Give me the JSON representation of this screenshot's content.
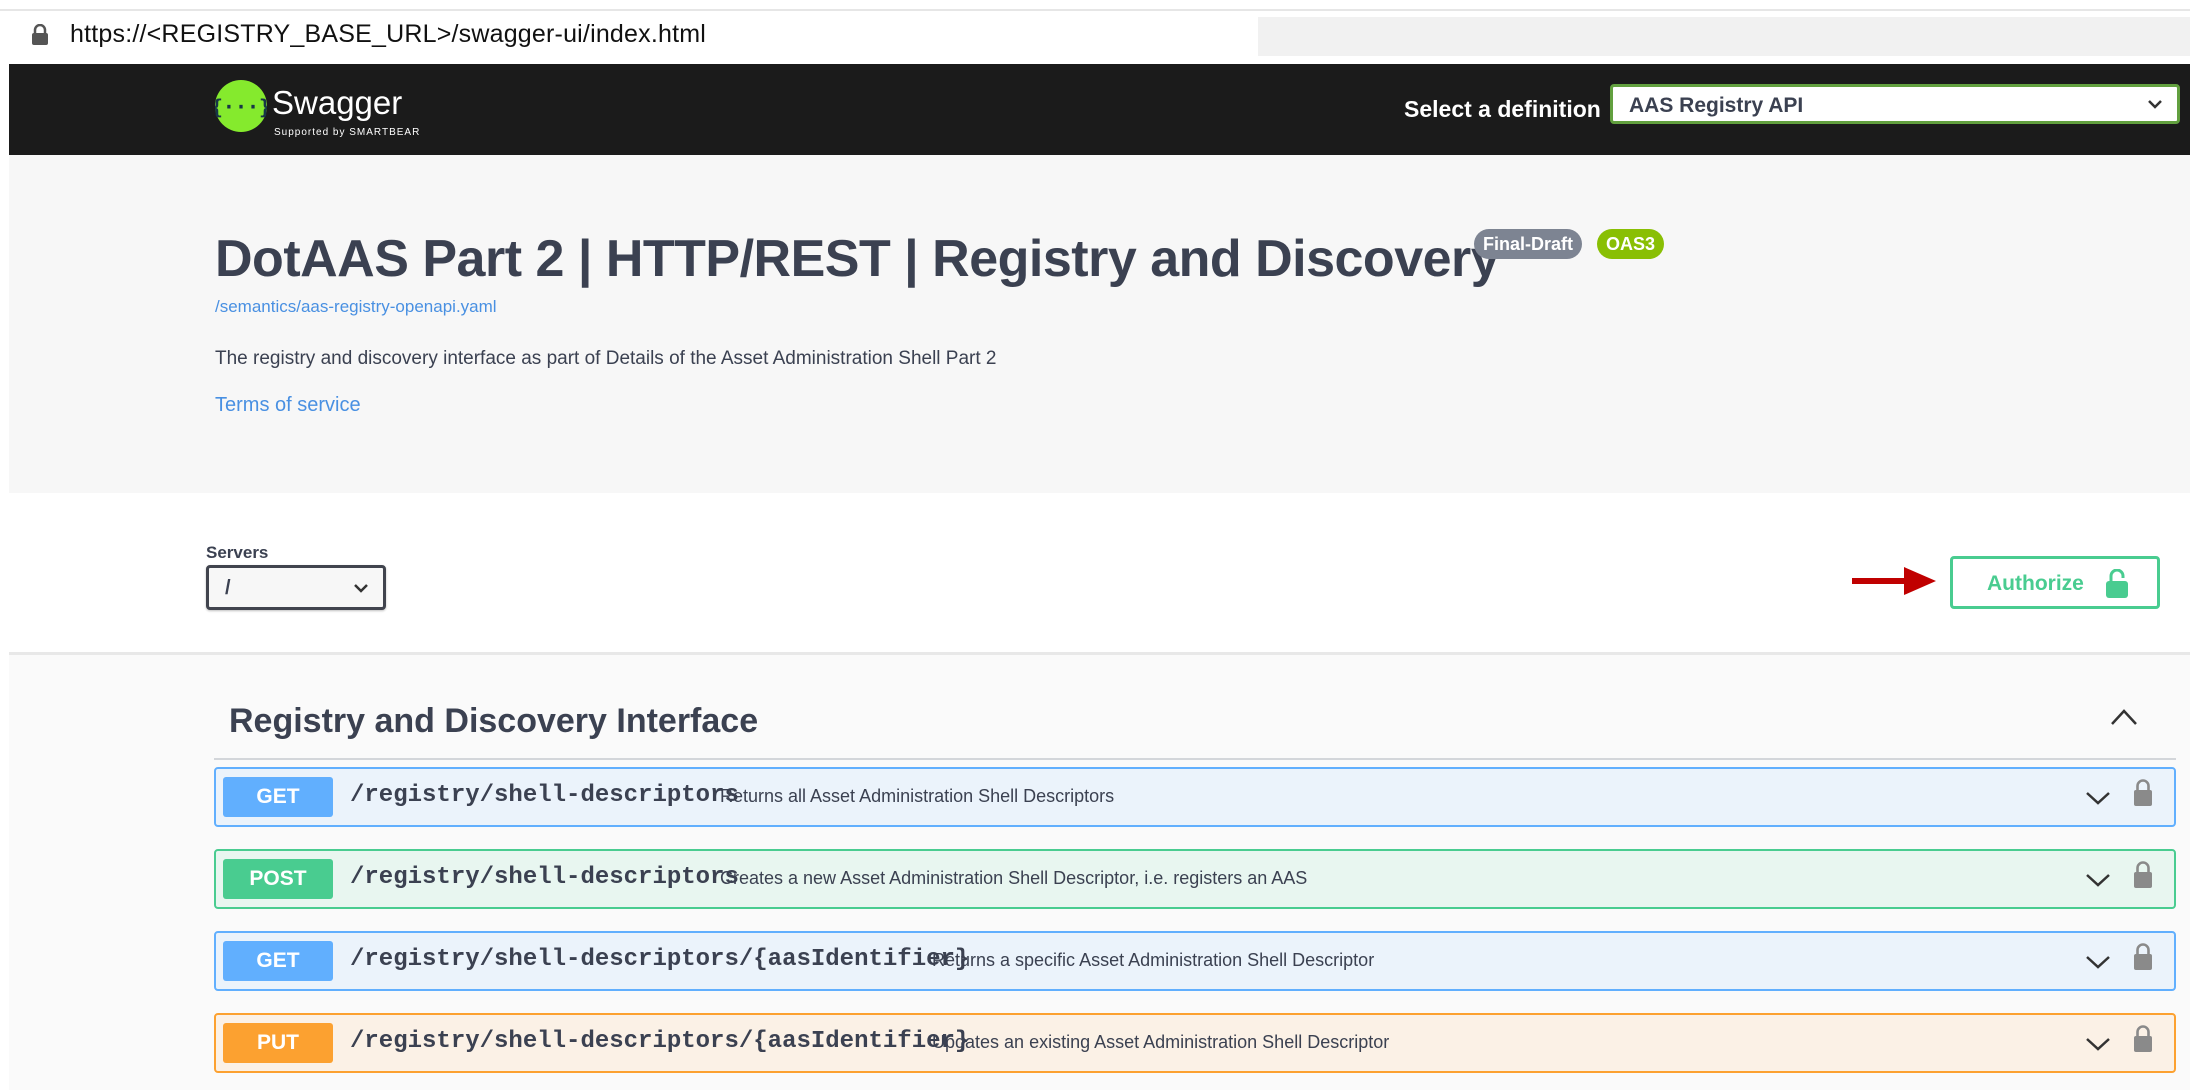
{
  "browser": {
    "url": "https://<REGISTRY_BASE_URL>/swagger-ui/index.html"
  },
  "topbar": {
    "logo_text": "Swagger",
    "logo_subtext": "Supported by SMARTBEAR",
    "definition_label": "Select a definition",
    "definition_selected": "AAS Registry API"
  },
  "info": {
    "title": "DotAAS Part 2 | HTTP/REST | Registry and Discovery",
    "version_badge": "Final-Draft",
    "oas_badge": "OAS3",
    "spec_link": "/semantics/aas-registry-openapi.yaml",
    "description": "The registry and discovery interface as part of Details of the Asset Administration Shell Part 2",
    "terms_link": "Terms of service"
  },
  "servers": {
    "label": "Servers",
    "selected": "/"
  },
  "authorize": {
    "label": "Authorize"
  },
  "tag": {
    "name": "Registry and Discovery Interface"
  },
  "operations": [
    {
      "method": "GET",
      "path": "/registry/shell-descriptors",
      "summary": "Returns all Asset Administration Shell Descriptors"
    },
    {
      "method": "POST",
      "path": "/registry/shell-descriptors",
      "summary": "Creates a new Asset Administration Shell Descriptor, i.e. registers an AAS"
    },
    {
      "method": "GET",
      "path": "/registry/shell-descriptors/{aasIdentifier}",
      "summary": "Returns a specific Asset Administration Shell Descriptor"
    },
    {
      "method": "PUT",
      "path": "/registry/shell-descriptors/{aasIdentifier}",
      "summary": "Updates an existing Asset Administration Shell Descriptor"
    }
  ],
  "colors": {
    "get": "#61affe",
    "post": "#49cc90",
    "put": "#fca130",
    "topbar": "#1b1b1b",
    "swagger_green": "#85ea2d",
    "arrow": "#c00000"
  }
}
